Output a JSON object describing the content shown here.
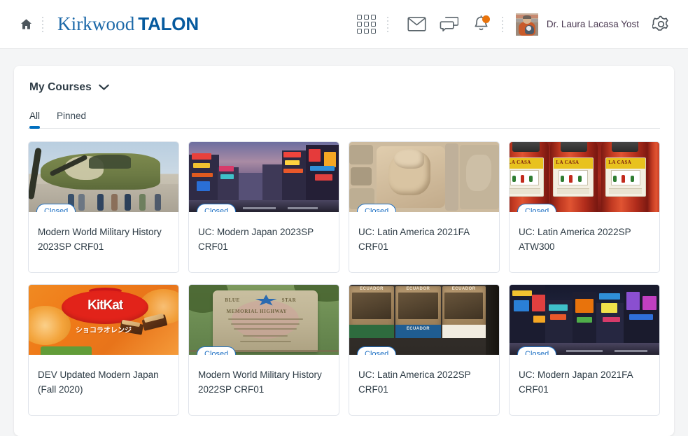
{
  "header": {
    "home_icon": "home-icon",
    "brand_part1": "Kirkwood",
    "brand_part2": "TALON",
    "waffle_icon": "apps-grid-icon",
    "mail_icon": "envelope-icon",
    "chat_icon": "chat-bubbles-icon",
    "bell_icon": "bell-icon",
    "notification_dot_color": "#e8730c",
    "avatar_label": "avatar",
    "username": "Dr. Laura Lacasa Yost",
    "gear_icon": "gear-icon"
  },
  "panel": {
    "title": "My Courses",
    "chevron_icon": "chevron-down-icon",
    "tabs": [
      {
        "label": "All",
        "active": true
      },
      {
        "label": "Pinned",
        "active": false
      }
    ],
    "accent_color": "#006fbf",
    "badge_color": "#1f71c4"
  },
  "courses": [
    {
      "title": "Modern World Military History 2023SP CRF01",
      "badge": "Closed",
      "art": "bomber"
    },
    {
      "title": "UC: Modern Japan 2023SP CRF01",
      "badge": "Closed",
      "art": "tokyo-dusk"
    },
    {
      "title": "UC: Latin America 2021FA CRF01",
      "badge": "Closed",
      "art": "maya-relief"
    },
    {
      "title": "UC: Latin America 2022SP ATW300",
      "badge": "Closed",
      "art": "salsa-bottles"
    },
    {
      "title": "DEV Updated Modern Japan (Fall 2020)",
      "badge": "",
      "art": "kitkat"
    },
    {
      "title": "Modern World Military History 2022SP CRF01",
      "badge": "Closed",
      "art": "blue-star-plaque"
    },
    {
      "title": "UC: Latin America 2022SP CRF01",
      "badge": "Closed",
      "art": "ecuador-chocolate"
    },
    {
      "title": "UC: Modern Japan 2021FA CRF01",
      "badge": "Closed",
      "art": "tokyo-night"
    }
  ],
  "art_text": {
    "salsa_brand": "LA CASA",
    "kitkat_brand": "KitKat",
    "kitkat_jp": "ショコラオレンジ",
    "plaque_line1": "BLUE",
    "plaque_line2": "STAR",
    "plaque_line3": "MEMORIAL  HIGHWAY",
    "choco_country": "ECUADOR",
    "choco_band": "ECUADOR"
  }
}
